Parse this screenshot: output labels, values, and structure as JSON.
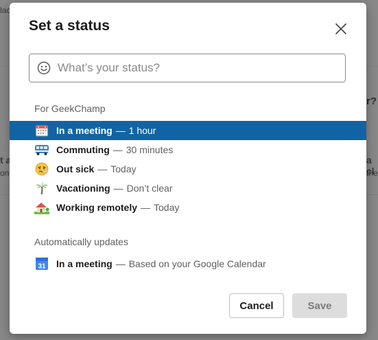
{
  "background": {
    "fragments": [
      "lac",
      "r?",
      "t a",
      "a cl",
      "on",
      "the"
    ]
  },
  "modal": {
    "title": "Set a status",
    "close_label": "Close",
    "status_input": {
      "placeholder": "What’s your status?",
      "value": ""
    },
    "presets_section": {
      "label": "For GeekChamp",
      "items": [
        {
          "icon": "calendar-icon",
          "name": "In a meeting",
          "separator": "—",
          "duration": "1 hour",
          "selected": true
        },
        {
          "icon": "bus-icon",
          "name": "Commuting",
          "separator": "—",
          "duration": "30 minutes",
          "selected": false
        },
        {
          "icon": "sick-face-icon",
          "name": "Out sick",
          "separator": "—",
          "duration": "Today",
          "selected": false
        },
        {
          "icon": "palm-tree-icon",
          "name": "Vacationing",
          "separator": "—",
          "duration": "Don’t clear",
          "selected": false
        },
        {
          "icon": "house-icon",
          "name": "Working remotely",
          "separator": "—",
          "duration": "Today",
          "selected": false
        }
      ]
    },
    "auto_section": {
      "label": "Automatically updates",
      "items": [
        {
          "icon": "google-calendar-icon",
          "icon_text": "31",
          "name": "In a meeting",
          "separator": "—",
          "duration": "Based on your Google Calendar"
        }
      ]
    },
    "buttons": {
      "cancel": "Cancel",
      "save": "Save"
    }
  },
  "colors": {
    "accent": "#1164a3",
    "overlay": "#888888",
    "save_disabled_bg": "#dddddd"
  }
}
